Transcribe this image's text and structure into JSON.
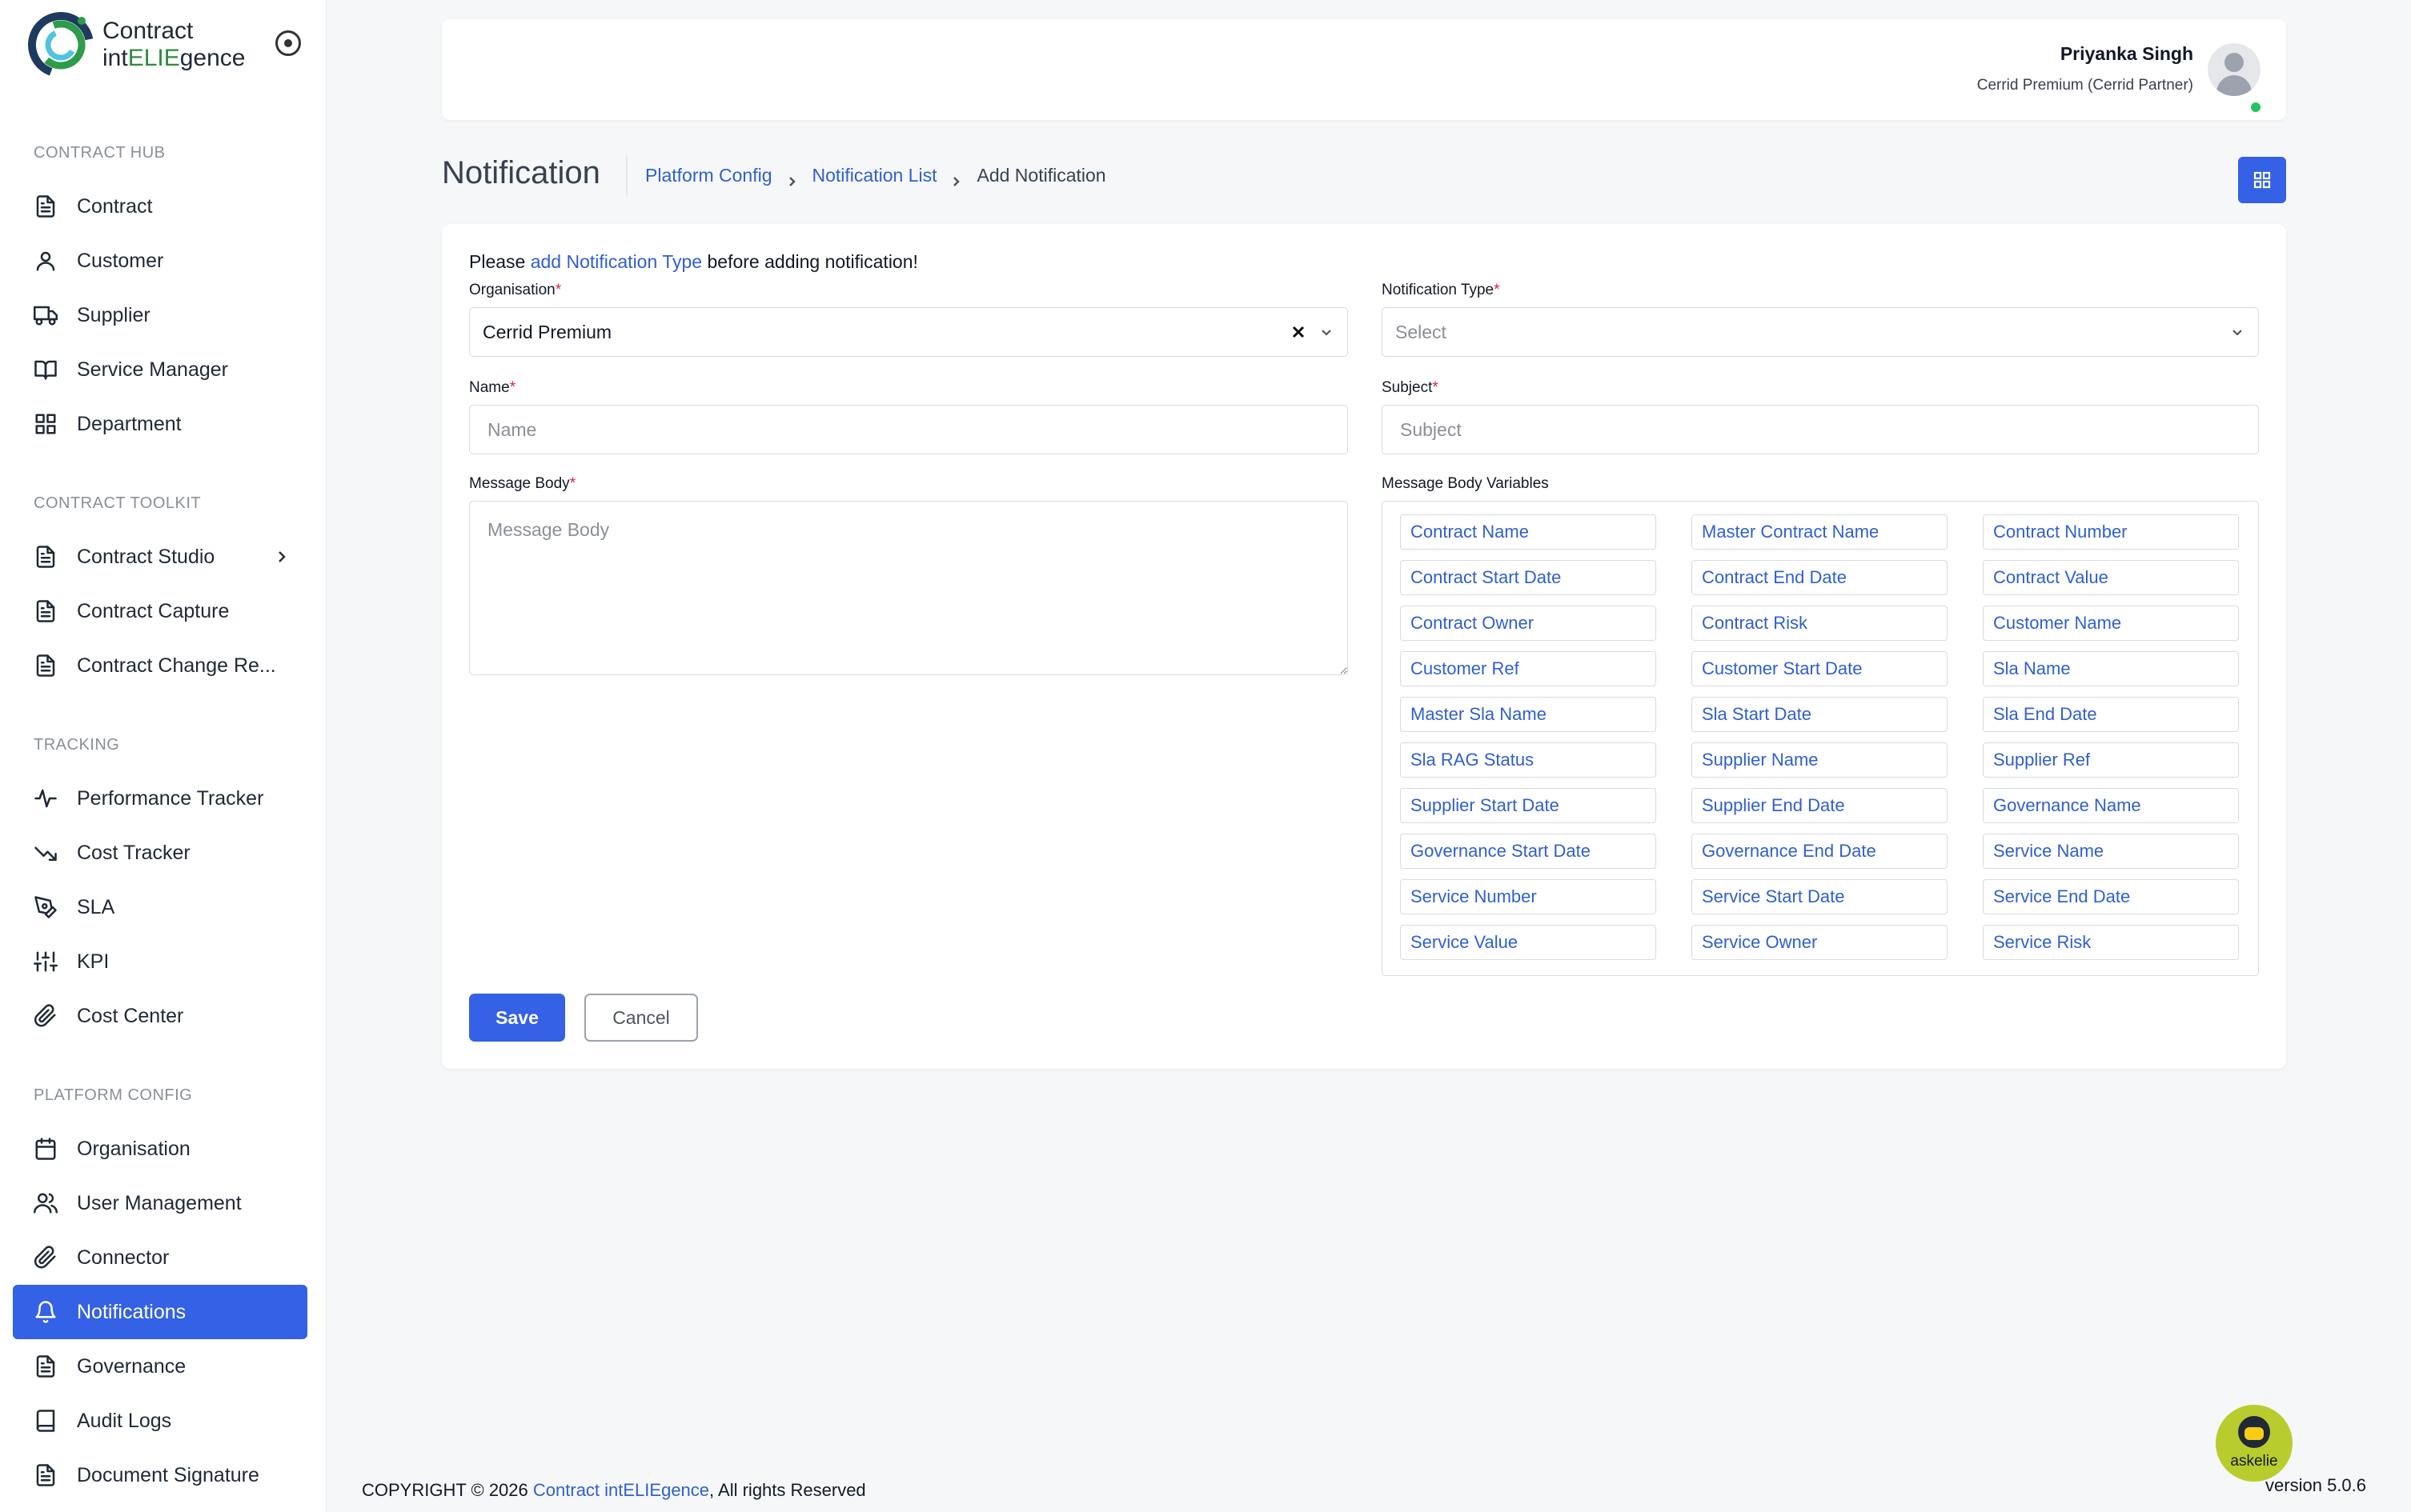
{
  "logo": {
    "line1": "Contract",
    "line2_prefix": "int",
    "line2_accent": "ELIE",
    "line2_suffix": "gence"
  },
  "sidebar": {
    "sections": [
      {
        "title": "CONTRACT HUB",
        "items": [
          {
            "label": "Contract",
            "icon": "file-text-icon"
          },
          {
            "label": "Customer",
            "icon": "user-icon"
          },
          {
            "label": "Supplier",
            "icon": "truck-icon"
          },
          {
            "label": "Service Manager",
            "icon": "book-open-icon"
          },
          {
            "label": "Department",
            "icon": "grid-icon"
          }
        ]
      },
      {
        "title": "CONTRACT TOOLKIT",
        "items": [
          {
            "label": "Contract Studio",
            "icon": "file-text-icon",
            "has_chevron": true
          },
          {
            "label": "Contract Capture",
            "icon": "file-text-icon"
          },
          {
            "label": "Contract Change Re...",
            "icon": "file-text-icon"
          }
        ]
      },
      {
        "title": "TRACKING",
        "items": [
          {
            "label": "Performance Tracker",
            "icon": "activity-icon"
          },
          {
            "label": "Cost Tracker",
            "icon": "trending-down-icon"
          },
          {
            "label": "SLA",
            "icon": "pen-tool-icon"
          },
          {
            "label": "KPI",
            "icon": "sliders-icon"
          },
          {
            "label": "Cost Center",
            "icon": "paperclip-icon"
          }
        ]
      },
      {
        "title": "PLATFORM CONFIG",
        "items": [
          {
            "label": "Organisation",
            "icon": "calendar-icon"
          },
          {
            "label": "User Management",
            "icon": "users-icon"
          },
          {
            "label": "Connector",
            "icon": "paperclip-icon"
          },
          {
            "label": "Notifications",
            "icon": "bell-icon",
            "active": true
          },
          {
            "label": "Governance",
            "icon": "file-text-icon"
          },
          {
            "label": "Audit Logs",
            "icon": "book-icon"
          },
          {
            "label": "Document Signature",
            "icon": "file-text-icon"
          }
        ]
      }
    ]
  },
  "header": {
    "user_name": "Priyanka Singh",
    "user_role": "Cerrid Premium (Cerrid Partner)"
  },
  "page": {
    "title": "Notification",
    "breadcrumb": {
      "crumb1": "Platform Config",
      "crumb2": "Notification List",
      "current": "Add Notification"
    }
  },
  "form": {
    "notice_prefix": "Please ",
    "notice_link": "add Notification Type",
    "notice_suffix": " before adding notification!",
    "organisation": {
      "label": "Organisation",
      "value": "Cerrid Premium"
    },
    "notification_type": {
      "label": "Notification Type",
      "placeholder": "Select"
    },
    "name": {
      "label": "Name",
      "placeholder": "Name"
    },
    "subject": {
      "label": "Subject",
      "placeholder": "Subject"
    },
    "message_body": {
      "label": "Message Body",
      "placeholder": "Message Body"
    },
    "variables_label": "Message Body Variables",
    "variables": [
      "Contract Name",
      "Master Contract Name",
      "Contract Number",
      "Contract Start Date",
      "Contract End Date",
      "Contract Value",
      "Contract Owner",
      "Contract Risk",
      "Customer Name",
      "Customer Ref",
      "Customer Start Date",
      "Sla Name",
      "Master Sla Name",
      "Sla Start Date",
      "Sla End Date",
      "Sla RAG Status",
      "Supplier Name",
      "Supplier Ref",
      "Supplier Start Date",
      "Supplier End Date",
      "Governance Name",
      "Governance Start Date",
      "Governance End Date",
      "Service Name",
      "Service Number",
      "Service Start Date",
      "Service End Date",
      "Service Value",
      "Service Owner",
      "Service Risk"
    ],
    "save_label": "Save",
    "cancel_label": "Cancel"
  },
  "footer": {
    "copyright_prefix": "COPYRIGHT © 2026 ",
    "copyright_link": "Contract intELIEgence",
    "copyright_suffix": ", All rights Reserved",
    "version": "version 5.0.6"
  },
  "askelie_label": "askelie",
  "colors": {
    "primary": "#3461e5",
    "link": "#2f5fd0",
    "required": "#e11d48",
    "online": "#22c55e",
    "logo_accent": "#2e8b3e"
  }
}
